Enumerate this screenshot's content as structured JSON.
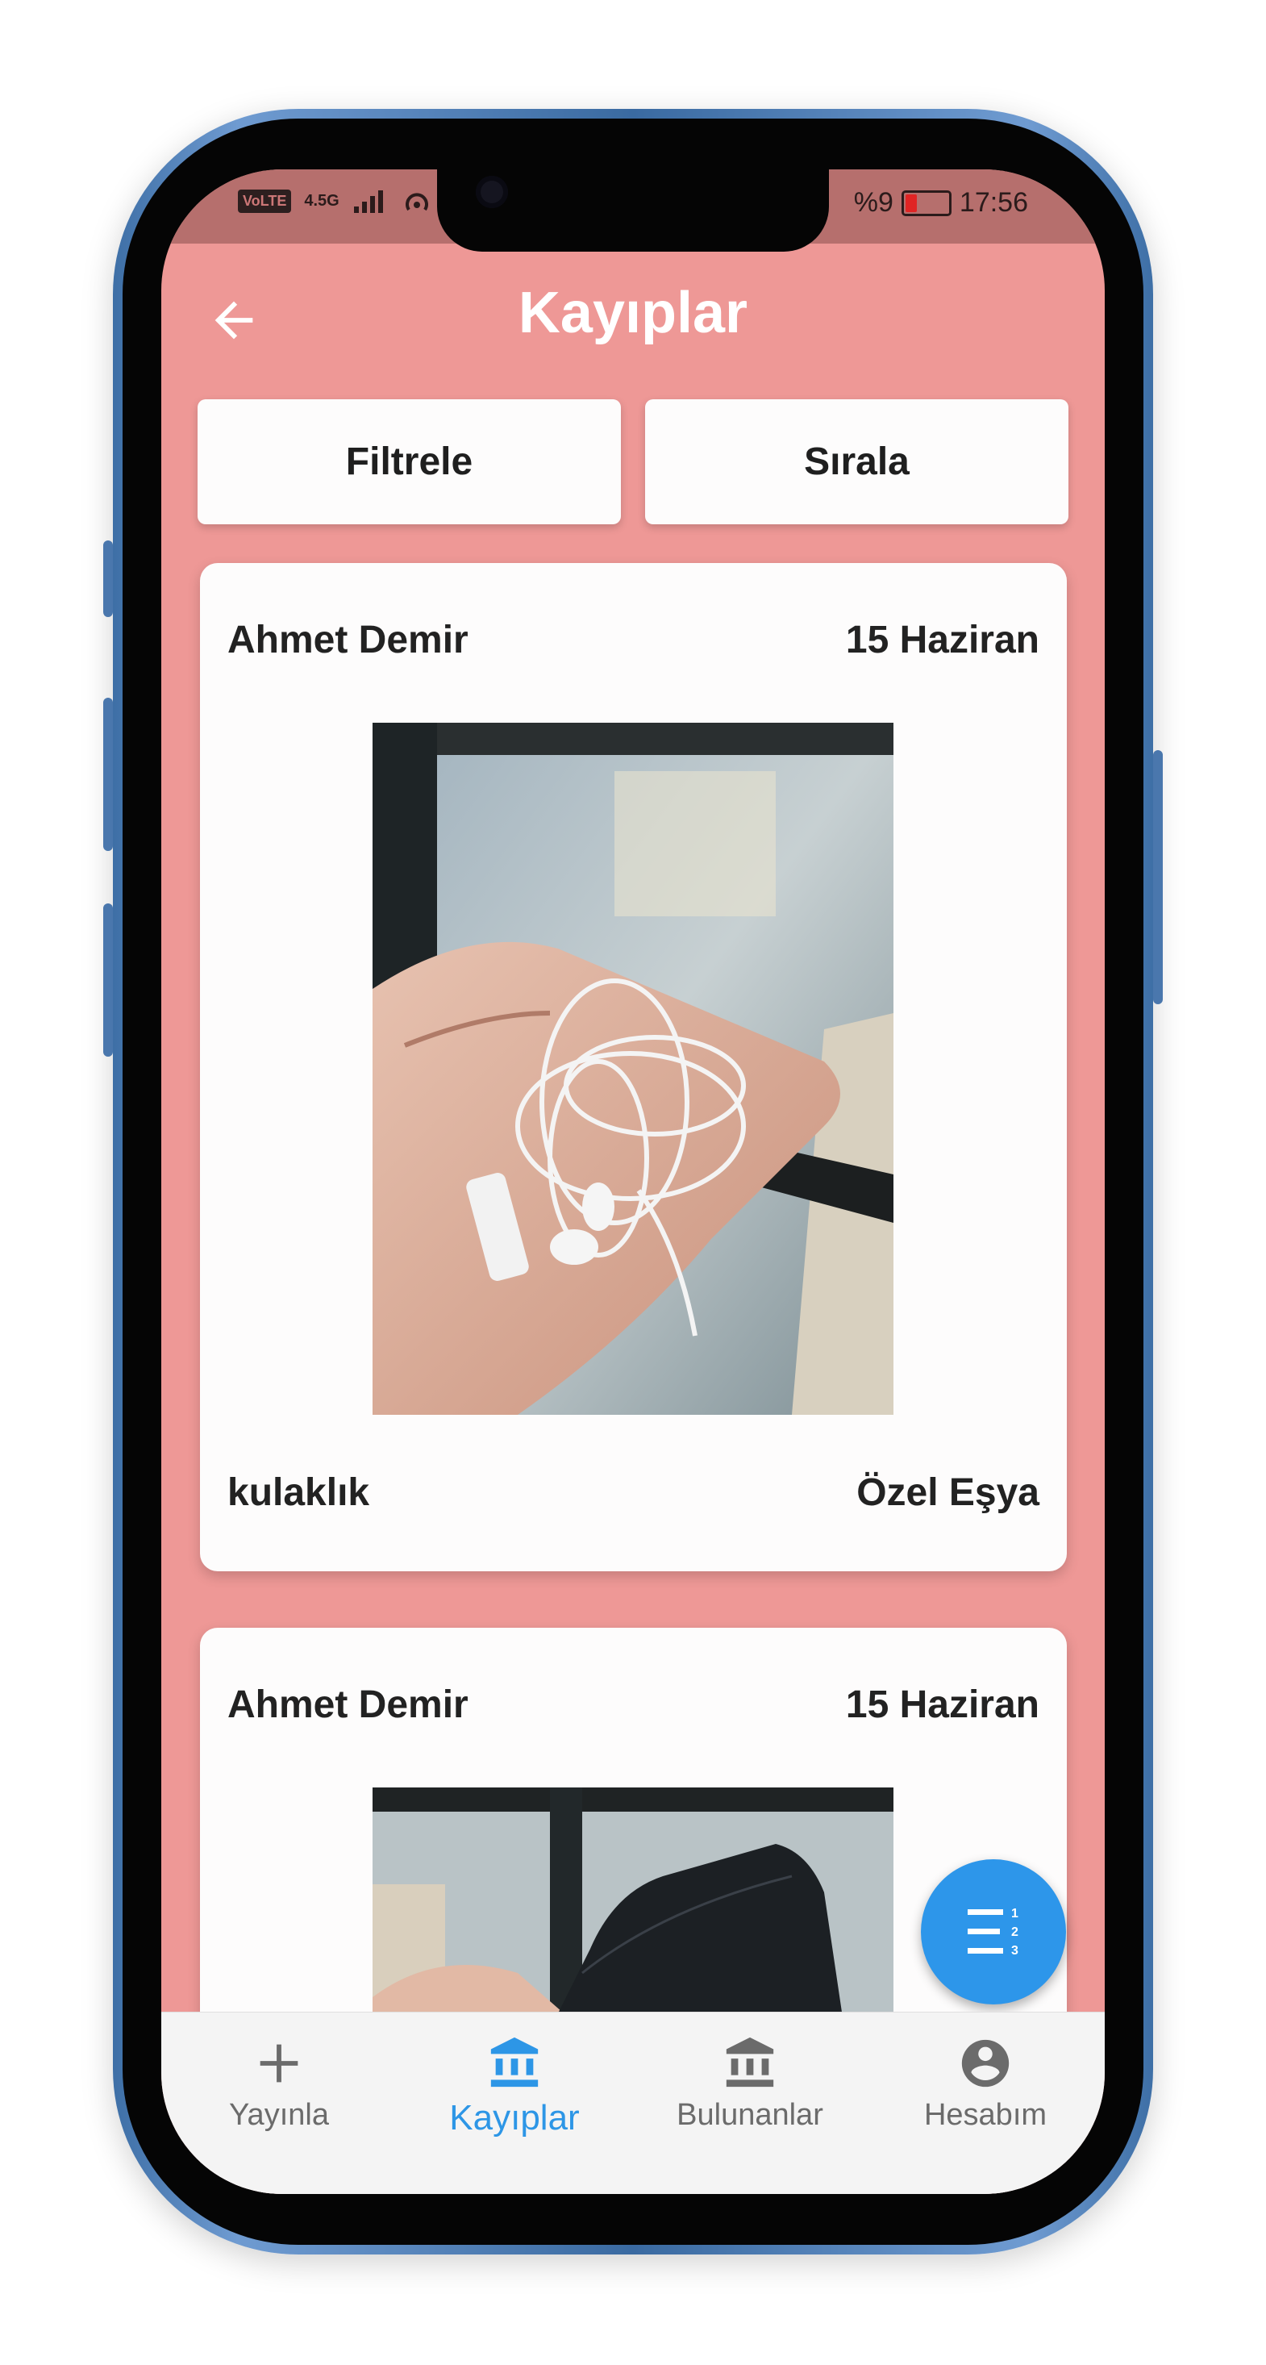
{
  "status_bar": {
    "volte": "VoLTE",
    "network": "4.5G",
    "signal_sup": "1",
    "battery_text": "%9",
    "time": "17:56"
  },
  "app_bar": {
    "title": "Kayıplar"
  },
  "actions": {
    "filter_label": "Filtrele",
    "sort_label": "Sırala"
  },
  "cards": [
    {
      "owner": "Ahmet Demir",
      "date": "15 Haziran",
      "item": "kulaklık",
      "category": "Özel Eşya"
    },
    {
      "owner": "Ahmet Demir",
      "date": "15 Haziran"
    }
  ],
  "bottom_nav": {
    "items": [
      {
        "label": "Yayınla",
        "icon": "plus-icon",
        "active": false
      },
      {
        "label": "Kayıplar",
        "icon": "bank-icon",
        "active": true
      },
      {
        "label": "Bulunanlar",
        "icon": "bank-icon",
        "active": false
      },
      {
        "label": "Hesabım",
        "icon": "account-circle-icon",
        "active": false
      }
    ]
  },
  "colors": {
    "background": "#ee9896",
    "status_bar": "#b66f6d",
    "accent": "#2d96ea",
    "card": "#fdfcfc"
  }
}
